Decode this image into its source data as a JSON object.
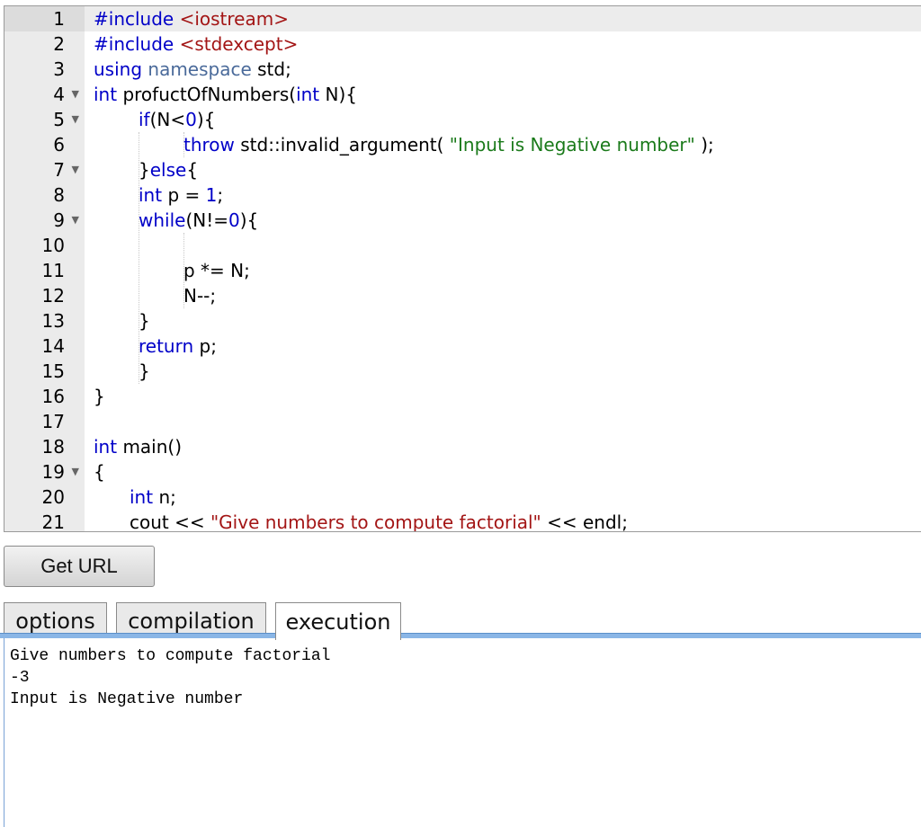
{
  "editor": {
    "active_line": 1,
    "lines": [
      {
        "n": "1",
        "fold": false,
        "tokens": [
          {
            "t": "#include ",
            "c": "kw"
          },
          {
            "t": "<iostream>",
            "c": "str"
          }
        ]
      },
      {
        "n": "2",
        "fold": false,
        "tokens": [
          {
            "t": "#include ",
            "c": "kw"
          },
          {
            "t": "<stdexcept>",
            "c": "str"
          }
        ]
      },
      {
        "n": "3",
        "fold": false,
        "tokens": [
          {
            "t": "using ",
            "c": "kw"
          },
          {
            "t": "namespace ",
            "c": "ns"
          },
          {
            "t": "std;",
            "c": ""
          }
        ]
      },
      {
        "n": "4",
        "fold": true,
        "tokens": [
          {
            "t": "int ",
            "c": "kw"
          },
          {
            "t": "profuctOfNumbers(",
            "c": ""
          },
          {
            "t": "int ",
            "c": "kw"
          },
          {
            "t": "N){",
            "c": ""
          }
        ]
      },
      {
        "n": "5",
        "fold": true,
        "indent": 1,
        "tokens": [
          {
            "t": "if",
            "c": "kw"
          },
          {
            "t": "(N<",
            "c": ""
          },
          {
            "t": "0",
            "c": "num-lit"
          },
          {
            "t": "){",
            "c": ""
          }
        ]
      },
      {
        "n": "6",
        "fold": false,
        "indent": 2,
        "tokens": [
          {
            "t": "throw ",
            "c": "kw"
          },
          {
            "t": "std::invalid_argument( ",
            "c": ""
          },
          {
            "t": "\"Input is Negative number\"",
            "c": "lit"
          },
          {
            "t": " );",
            "c": ""
          }
        ]
      },
      {
        "n": "7",
        "fold": true,
        "indent": 1,
        "tokens": [
          {
            "t": "}",
            "c": ""
          },
          {
            "t": "else",
            "c": "kw"
          },
          {
            "t": "{",
            "c": ""
          }
        ]
      },
      {
        "n": "8",
        "fold": false,
        "indent": 1,
        "tokens": [
          {
            "t": "int ",
            "c": "kw"
          },
          {
            "t": "p = ",
            "c": ""
          },
          {
            "t": "1",
            "c": "num-lit"
          },
          {
            "t": ";",
            "c": ""
          }
        ]
      },
      {
        "n": "9",
        "fold": true,
        "indent": 1,
        "tokens": [
          {
            "t": "while",
            "c": "kw"
          },
          {
            "t": "(N!=",
            "c": ""
          },
          {
            "t": "0",
            "c": "num-lit"
          },
          {
            "t": "){",
            "c": ""
          }
        ]
      },
      {
        "n": "10",
        "fold": false,
        "tokens": []
      },
      {
        "n": "11",
        "fold": false,
        "indent": 2,
        "tokens": [
          {
            "t": "p *= N;",
            "c": ""
          }
        ]
      },
      {
        "n": "12",
        "fold": false,
        "indent": 2,
        "tokens": [
          {
            "t": "N--;",
            "c": ""
          }
        ]
      },
      {
        "n": "13",
        "fold": false,
        "indent": 1,
        "tokens": [
          {
            "t": "}",
            "c": ""
          }
        ]
      },
      {
        "n": "14",
        "fold": false,
        "indent": 1,
        "tokens": [
          {
            "t": "return ",
            "c": "kw"
          },
          {
            "t": "p;",
            "c": ""
          }
        ]
      },
      {
        "n": "15",
        "fold": false,
        "indent": 1,
        "tokens": [
          {
            "t": "}",
            "c": ""
          }
        ]
      },
      {
        "n": "16",
        "fold": false,
        "tokens": [
          {
            "t": "}",
            "c": ""
          }
        ]
      },
      {
        "n": "17",
        "fold": false,
        "tokens": []
      },
      {
        "n": "18",
        "fold": false,
        "tokens": [
          {
            "t": "int ",
            "c": "kw"
          },
          {
            "t": "main()",
            "c": ""
          }
        ]
      },
      {
        "n": "19",
        "fold": true,
        "tokens": [
          {
            "t": "{",
            "c": ""
          }
        ]
      },
      {
        "n": "20",
        "fold": false,
        "indent": 0.8,
        "tokens": [
          {
            "t": "int ",
            "c": "kw"
          },
          {
            "t": "n;",
            "c": ""
          }
        ]
      },
      {
        "n": "21",
        "fold": false,
        "indent": 0.8,
        "tokens": [
          {
            "t": "cout << ",
            "c": ""
          },
          {
            "t": "\"Give numbers to compute factorial\"",
            "c": "str"
          },
          {
            "t": " << endl;",
            "c": ""
          }
        ]
      }
    ]
  },
  "toolbar": {
    "get_url_label": "Get URL"
  },
  "tabs": [
    {
      "label": "options",
      "active": false
    },
    {
      "label": "compilation",
      "active": false
    },
    {
      "label": "execution",
      "active": true
    }
  ],
  "output": {
    "lines": [
      "Give numbers to compute factorial",
      "-3",
      "Input is Negative number"
    ]
  }
}
